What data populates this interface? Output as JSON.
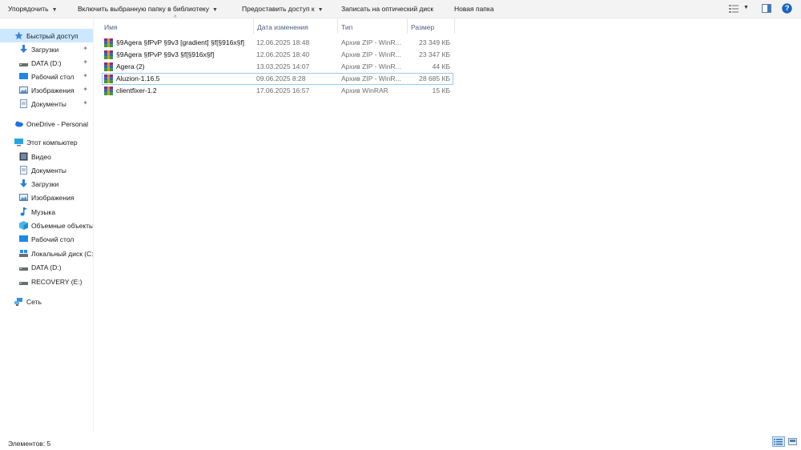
{
  "toolbar": {
    "organize": "Упорядочить",
    "include_library": "Включить выбранную папку в библиотеку",
    "share": "Предоставить доступ к",
    "burn": "Записать на оптический диск",
    "new_folder": "Новая папка",
    "dropdown_glyph": "▼",
    "help_glyph": "?"
  },
  "nav": {
    "quick_access": "Быстрый доступ",
    "quick_items": [
      {
        "label": "Загрузки",
        "icon": "download-icon"
      },
      {
        "label": "DATA (D:)",
        "icon": "drive-icon"
      },
      {
        "label": "Рабочий стол",
        "icon": "desktop-icon"
      },
      {
        "label": "Изображения",
        "icon": "pictures-icon"
      },
      {
        "label": "Документы",
        "icon": "documents-icon"
      }
    ],
    "onedrive": "OneDrive - Personal",
    "this_pc": "Этот компьютер",
    "pc_items": [
      {
        "label": "Видео",
        "icon": "video-icon"
      },
      {
        "label": "Документы",
        "icon": "documents-icon"
      },
      {
        "label": "Загрузки",
        "icon": "download-icon"
      },
      {
        "label": "Изображения",
        "icon": "pictures-icon"
      },
      {
        "label": "Музыка",
        "icon": "music-icon"
      },
      {
        "label": "Объемные объекты",
        "icon": "3d-objects-icon"
      },
      {
        "label": "Рабочий стол",
        "icon": "desktop-icon"
      },
      {
        "label": "Локальный диск (C:)",
        "icon": "local-disk-icon"
      },
      {
        "label": "DATA (D:)",
        "icon": "drive-icon"
      },
      {
        "label": "RECOVERY (E:)",
        "icon": "drive-icon"
      }
    ],
    "network": "Сеть"
  },
  "columns": {
    "name": "Имя",
    "date": "Дата изменения",
    "type": "Тип",
    "size": "Размер",
    "sort_glyph": "^"
  },
  "files": [
    {
      "name": "§9Agera §fPvP §9v3 [gradient] §f[§916x§f]",
      "date": "12.06.2025 18:48",
      "type": "Архив ZIP - WinR...",
      "size": "23 349 КБ"
    },
    {
      "name": "§9Agera §fPvP §9v3 §f[§916x§f]",
      "date": "12.06.2025 18:40",
      "type": "Архив ZIP - WinR...",
      "size": "23 347 КБ"
    },
    {
      "name": "Agera (2)",
      "date": "13.03.2025 14:07",
      "type": "Архив ZIP - WinR...",
      "size": "44 КБ"
    },
    {
      "name": "Aluzion-1.16.5",
      "date": "09.06.2025 8:28",
      "type": "Архив ZIP - WinR...",
      "size": "28 685 КБ"
    },
    {
      "name": "clientfixer-1.2",
      "date": "17.06.2025 16:57",
      "type": "Архив WinRAR",
      "size": "15 КБ"
    }
  ],
  "status": {
    "count": "Элементов: 5"
  }
}
